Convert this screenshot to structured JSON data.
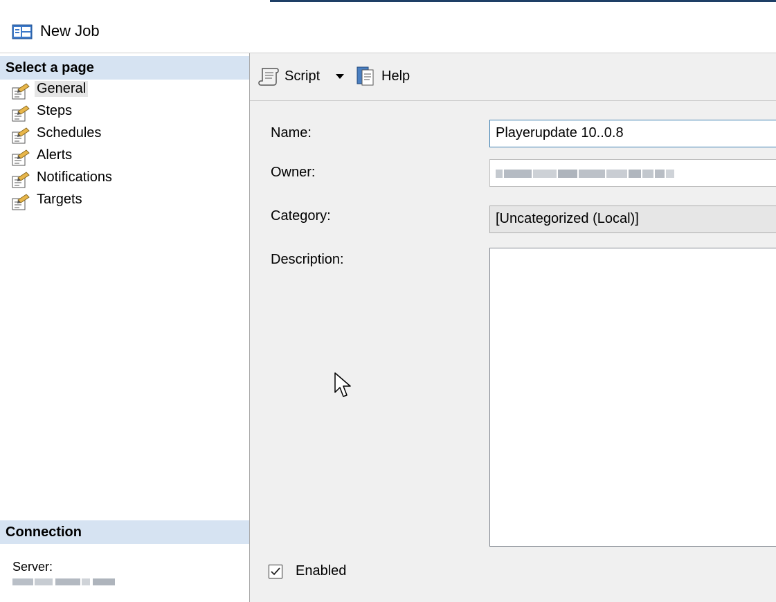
{
  "window": {
    "title": "New Job"
  },
  "sidebar": {
    "select_page_heading": "Select a page",
    "pages": [
      {
        "label": "General",
        "selected": true
      },
      {
        "label": "Steps"
      },
      {
        "label": "Schedules"
      },
      {
        "label": "Alerts"
      },
      {
        "label": "Notifications"
      },
      {
        "label": "Targets"
      }
    ],
    "connection_heading": "Connection",
    "server_label": "Server:"
  },
  "toolbar": {
    "script_label": "Script",
    "help_label": "Help"
  },
  "form": {
    "name_label": "Name:",
    "name_value": "Playerupdate 10..0.8",
    "owner_label": "Owner:",
    "category_label": "Category:",
    "category_value": "[Uncategorized (Local)]",
    "description_label": "Description:",
    "enabled_label": "Enabled",
    "enabled_checked": true
  }
}
